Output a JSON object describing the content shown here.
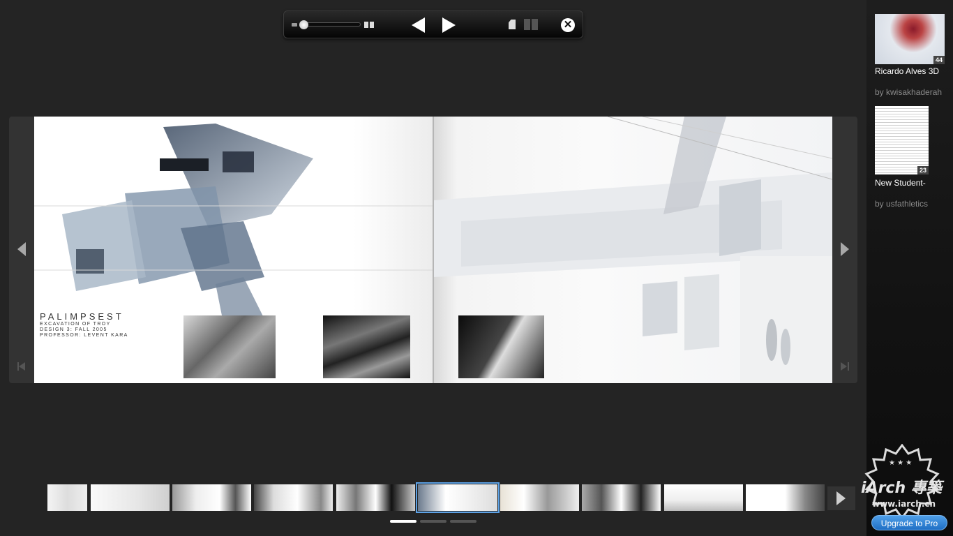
{
  "controls": {
    "icons": [
      "zoom-slider",
      "zoom-max-icon",
      "previous-page-icon",
      "next-page-icon",
      "single-page-view-icon",
      "two-page-view-icon",
      "close-icon"
    ],
    "zoom_level": 0.0,
    "close_glyph": "✕"
  },
  "document": {
    "title": "PALIMPSEST",
    "subtitle_lines": [
      "EXCAVATION OF TROY",
      "DESIGN 3: FALL 2005",
      "PROFESSOR: LEVENT KARA"
    ]
  },
  "thumbnails": {
    "count": 11,
    "active_index": 5,
    "pager_pages": 3,
    "pager_active": 0
  },
  "related": [
    {
      "title": "Ricardo Alves 3D",
      "author": "by kwisakhaderah",
      "pages": "44"
    },
    {
      "title": "New Student-",
      "author": "by usfathletics",
      "pages": "23"
    }
  ],
  "upgrade_label": "Upgrade to Pro",
  "watermark": {
    "brand": "iArch 專築",
    "url": "www.iarch.cn"
  },
  "colors": {
    "accent": "#2f7fd6",
    "background": "#242424",
    "active_thumb": "#5da2e6"
  }
}
